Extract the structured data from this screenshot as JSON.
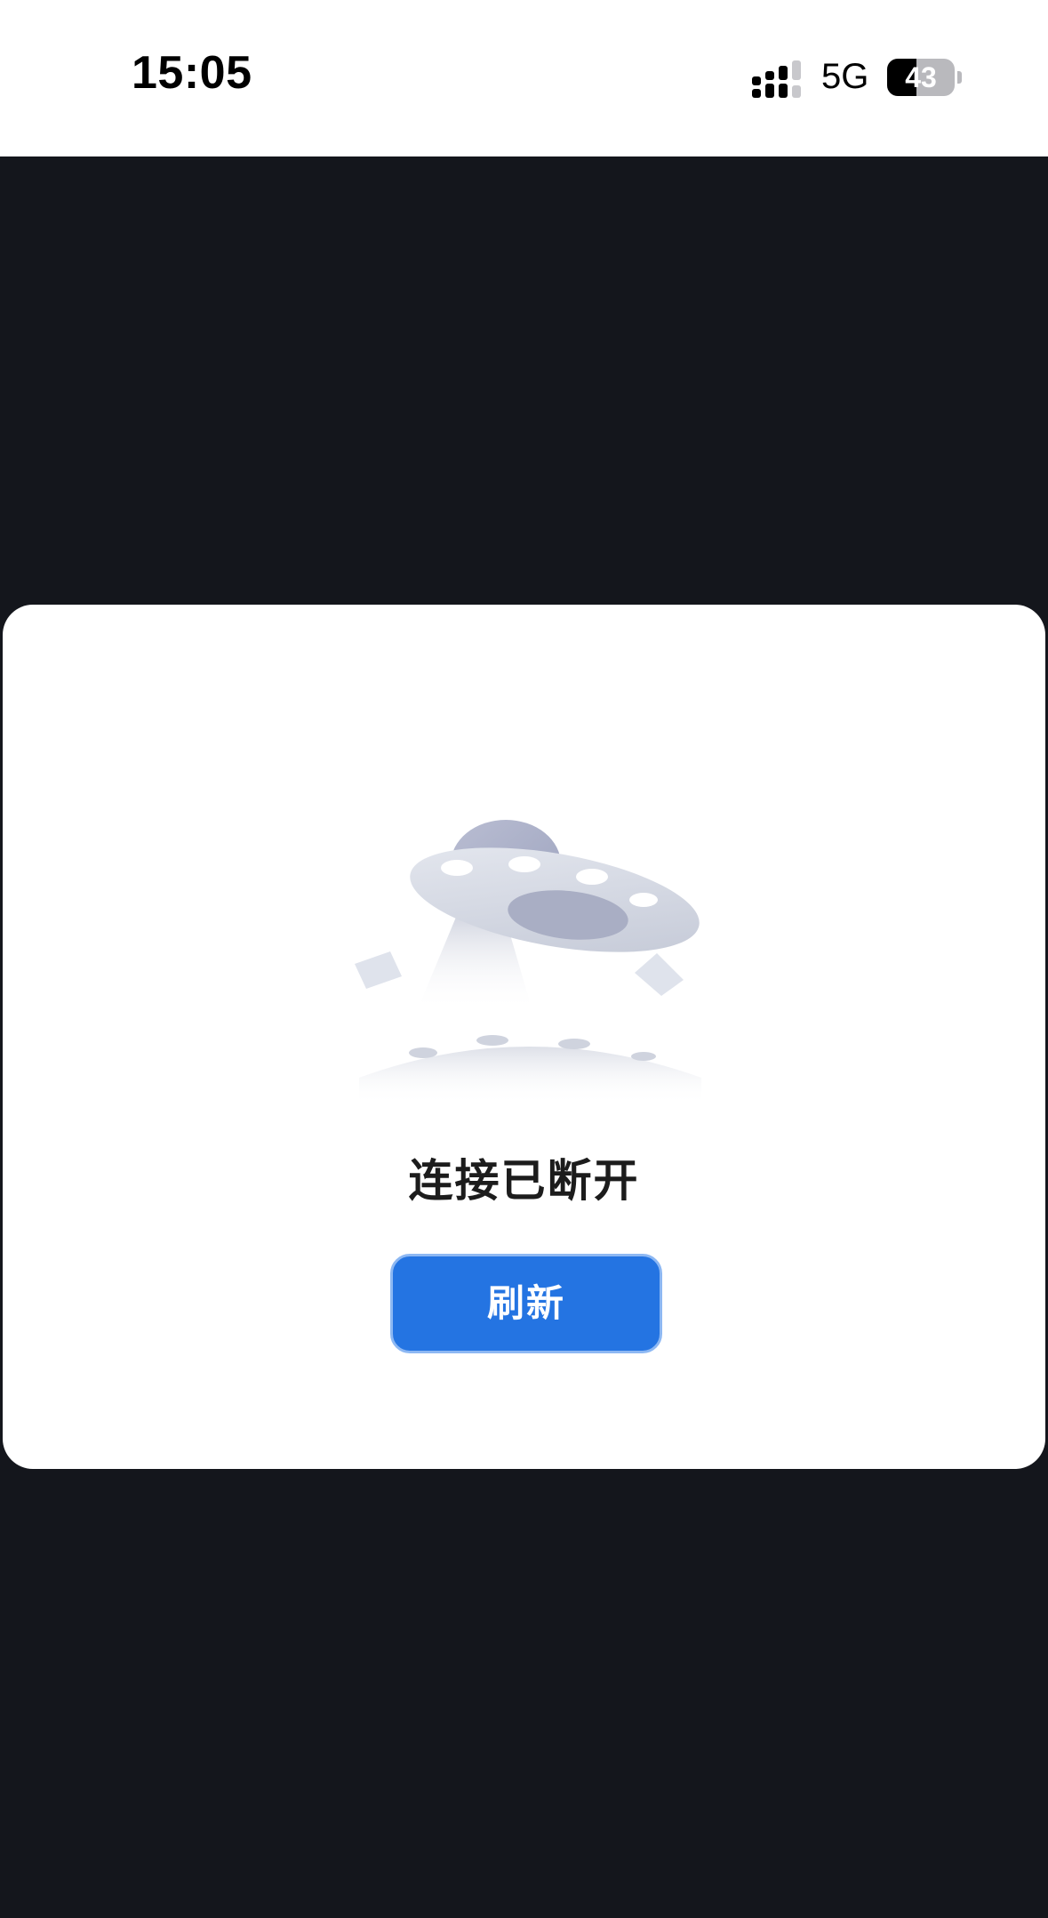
{
  "status_bar": {
    "time": "15:05",
    "network": "5G",
    "battery_level": "43",
    "battery_fraction": 0.43
  },
  "dialog": {
    "illustration_icon": "ufo-icon",
    "message": "连接已断开",
    "refresh_label": "刷新"
  },
  "colors": {
    "background": "#14161c",
    "dialog": "#ffffff",
    "button": "#2474e2",
    "text": "#1c1c1c"
  }
}
